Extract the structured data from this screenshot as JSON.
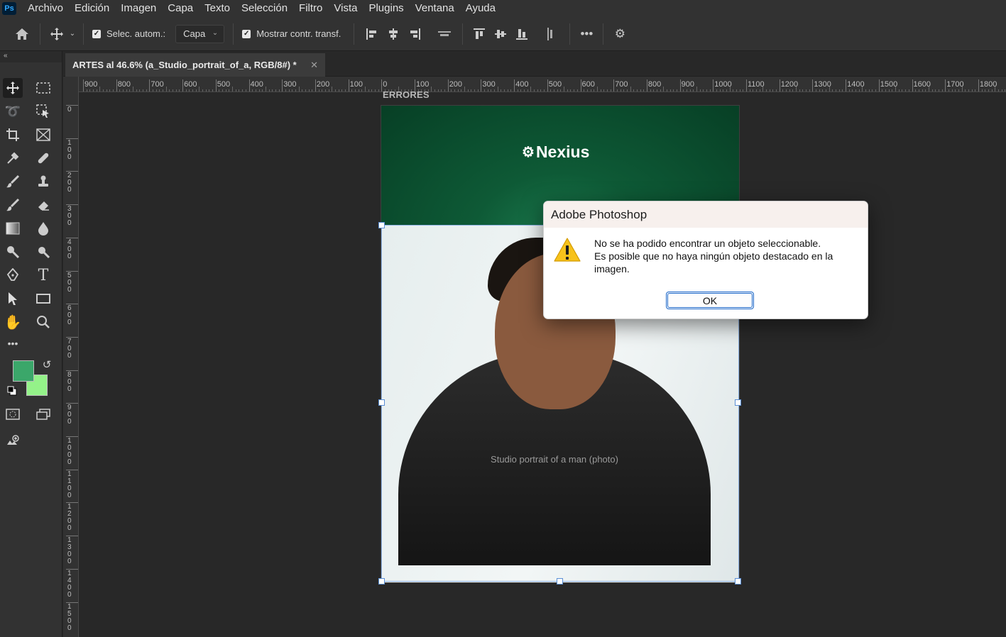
{
  "app": {
    "logo": "Ps"
  },
  "menu": [
    "Archivo",
    "Edición",
    "Imagen",
    "Capa",
    "Texto",
    "Selección",
    "Filtro",
    "Vista",
    "Plugins",
    "Ventana",
    "Ayuda"
  ],
  "options": {
    "auto_select_label": "Selec. autom.:",
    "auto_select_checked": true,
    "auto_select_target": "Capa",
    "show_transform_label": "Mostrar contr. transf.",
    "show_transform_checked": true
  },
  "document": {
    "tab_title": "ARTES al 46.6% (a_Studio_portrait_of_a, RGB/8#) *",
    "artboard_name": "ERRORES",
    "logo_text": "Nexius",
    "photo_alt": "Studio portrait of a man (photo)"
  },
  "rulers": {
    "top": [
      "900",
      "800",
      "700",
      "600",
      "500",
      "400",
      "300",
      "200",
      "100",
      "0",
      "100",
      "200",
      "300",
      "400",
      "500",
      "600",
      "700",
      "800",
      "900",
      "1000",
      "1100",
      "1200",
      "1300",
      "1400",
      "1500",
      "1600",
      "1700",
      "1800"
    ],
    "left": [
      "0",
      "1\n0\n0",
      "2\n0\n0",
      "3\n0\n0",
      "4\n0\n0",
      "5\n0\n0",
      "6\n0\n0",
      "7\n0\n0",
      "8\n0\n0",
      "9\n0\n0",
      "1\n0\n0\n0",
      "1\n1\n0\n0",
      "1\n2\n0\n0",
      "1\n3\n0\n0",
      "1\n4\n0\n0",
      "1\n5\n0\n0"
    ]
  },
  "colors": {
    "foreground": "#3ba76a",
    "background": "#94f289",
    "artboard_green": "#0a4a2c"
  },
  "dialog": {
    "title": "Adobe Photoshop",
    "message_line1": "No se ha podido encontrar un objeto seleccionable.",
    "message_line2": "Es posible que no haya ningún objeto destacado en la imagen.",
    "ok_label": "OK",
    "icon": "warning-icon"
  }
}
